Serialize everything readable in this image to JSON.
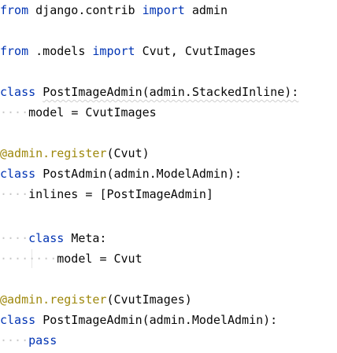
{
  "editor": {
    "colors": {
      "keyword": "#0033b3",
      "decorator": "#9e880d",
      "text": "#080808",
      "whitespace": "#c8c8c8",
      "background": "#ffffff"
    },
    "lines": [
      {
        "tokens": [
          {
            "t": "from",
            "c": "kw"
          },
          {
            "t": " ",
            "c": "ws"
          },
          {
            "t": "django.contrib"
          },
          {
            "t": " ",
            "c": "ws"
          },
          {
            "t": "import",
            "c": "kw"
          },
          {
            "t": " ",
            "c": "ws"
          },
          {
            "t": "admin"
          }
        ]
      },
      {
        "tokens": []
      },
      {
        "tokens": [
          {
            "t": "from",
            "c": "kw"
          },
          {
            "t": " ",
            "c": "ws"
          },
          {
            "t": ".models"
          },
          {
            "t": " ",
            "c": "ws"
          },
          {
            "t": "import",
            "c": "kw"
          },
          {
            "t": " ",
            "c": "ws"
          },
          {
            "t": "Cvut,"
          },
          {
            "t": " ",
            "c": "ws"
          },
          {
            "t": "CvutImages"
          }
        ]
      },
      {
        "tokens": []
      },
      {
        "tokens": [
          {
            "t": "class",
            "c": "kw"
          },
          {
            "t": " ",
            "c": "ws"
          },
          {
            "t": "PostImageAdmin(admin.StackedInline):",
            "c": "squig"
          }
        ]
      },
      {
        "tokens": [
          {
            "t": "····",
            "c": "ws"
          },
          {
            "t": "model"
          },
          {
            "t": " ",
            "c": "ws"
          },
          {
            "t": "="
          },
          {
            "t": " ",
            "c": "ws"
          },
          {
            "t": "CvutImages"
          }
        ]
      },
      {
        "tokens": []
      },
      {
        "tokens": [
          {
            "t": "@admin.register",
            "c": "deco"
          },
          {
            "t": "(Cvut)"
          }
        ]
      },
      {
        "tokens": [
          {
            "t": "class",
            "c": "kw"
          },
          {
            "t": " ",
            "c": "ws"
          },
          {
            "t": "PostAdmin(admin.ModelAdmin):"
          }
        ]
      },
      {
        "tokens": [
          {
            "t": "····",
            "c": "ws"
          },
          {
            "t": "inlines"
          },
          {
            "t": " ",
            "c": "ws"
          },
          {
            "t": "="
          },
          {
            "t": " ",
            "c": "ws"
          },
          {
            "t": "[PostImageAdmin]"
          }
        ]
      },
      {
        "tokens": []
      },
      {
        "tokens": [
          {
            "t": "····",
            "c": "ws"
          },
          {
            "t": "class",
            "c": "kw"
          },
          {
            "t": " ",
            "c": "ws"
          },
          {
            "t": "Meta:"
          }
        ]
      },
      {
        "tokens": [
          {
            "t": "········",
            "c": "ws"
          },
          {
            "t": "model"
          },
          {
            "t": " ",
            "c": "ws"
          },
          {
            "t": "="
          },
          {
            "t": " ",
            "c": "ws"
          },
          {
            "t": "Cvut"
          }
        ]
      },
      {
        "tokens": []
      },
      {
        "tokens": [
          {
            "t": "@admin.register",
            "c": "deco"
          },
          {
            "t": "(CvutImages)"
          }
        ]
      },
      {
        "tokens": [
          {
            "t": "class",
            "c": "kw"
          },
          {
            "t": " ",
            "c": "ws"
          },
          {
            "t": "PostImageAdmin(admin.ModelAdmin):"
          }
        ]
      },
      {
        "tokens": [
          {
            "t": "····",
            "c": "ws"
          },
          {
            "t": "pass",
            "c": "kw"
          }
        ]
      }
    ]
  }
}
